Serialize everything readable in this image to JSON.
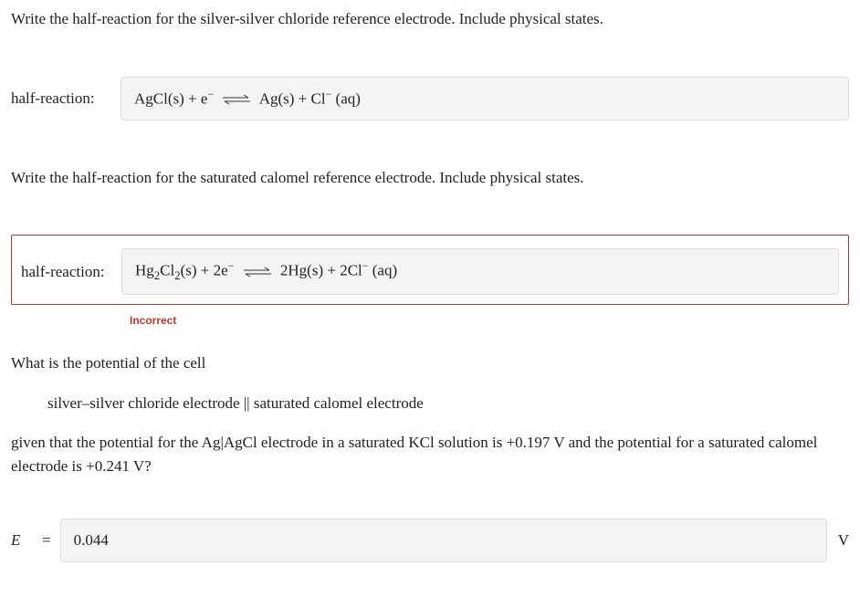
{
  "q1": {
    "prompt": "Write the half-reaction for the silver-silver chloride reference electrode. Include physical states.",
    "label": "half-reaction:",
    "reaction_left_1": "AgCl(s) + e",
    "reaction_right_1": " Ag(s) + Cl",
    "reaction_right_1_tail": " (aq)"
  },
  "q2": {
    "prompt": "Write the half-reaction for the saturated calomel reference electrode. Include physical states.",
    "label": "half-reaction:",
    "r_a": "Hg",
    "r_b": "Cl",
    "r_c": "(s) + 2e",
    "r_d": " 2Hg(s) + 2Cl",
    "r_e": " (aq)",
    "feedback": "Incorrect"
  },
  "q3": {
    "line1": "What is the potential of the cell",
    "line2": "silver–silver chloride electrode || saturated calomel electrode",
    "line3": "given that the potential for the Ag|AgCl electrode in a saturated KCl solution is +0.197 V and the potential for a saturated calomel electrode is +0.241 V?",
    "var": "E",
    "eq": "=",
    "value": "0.044",
    "unit": "V"
  }
}
